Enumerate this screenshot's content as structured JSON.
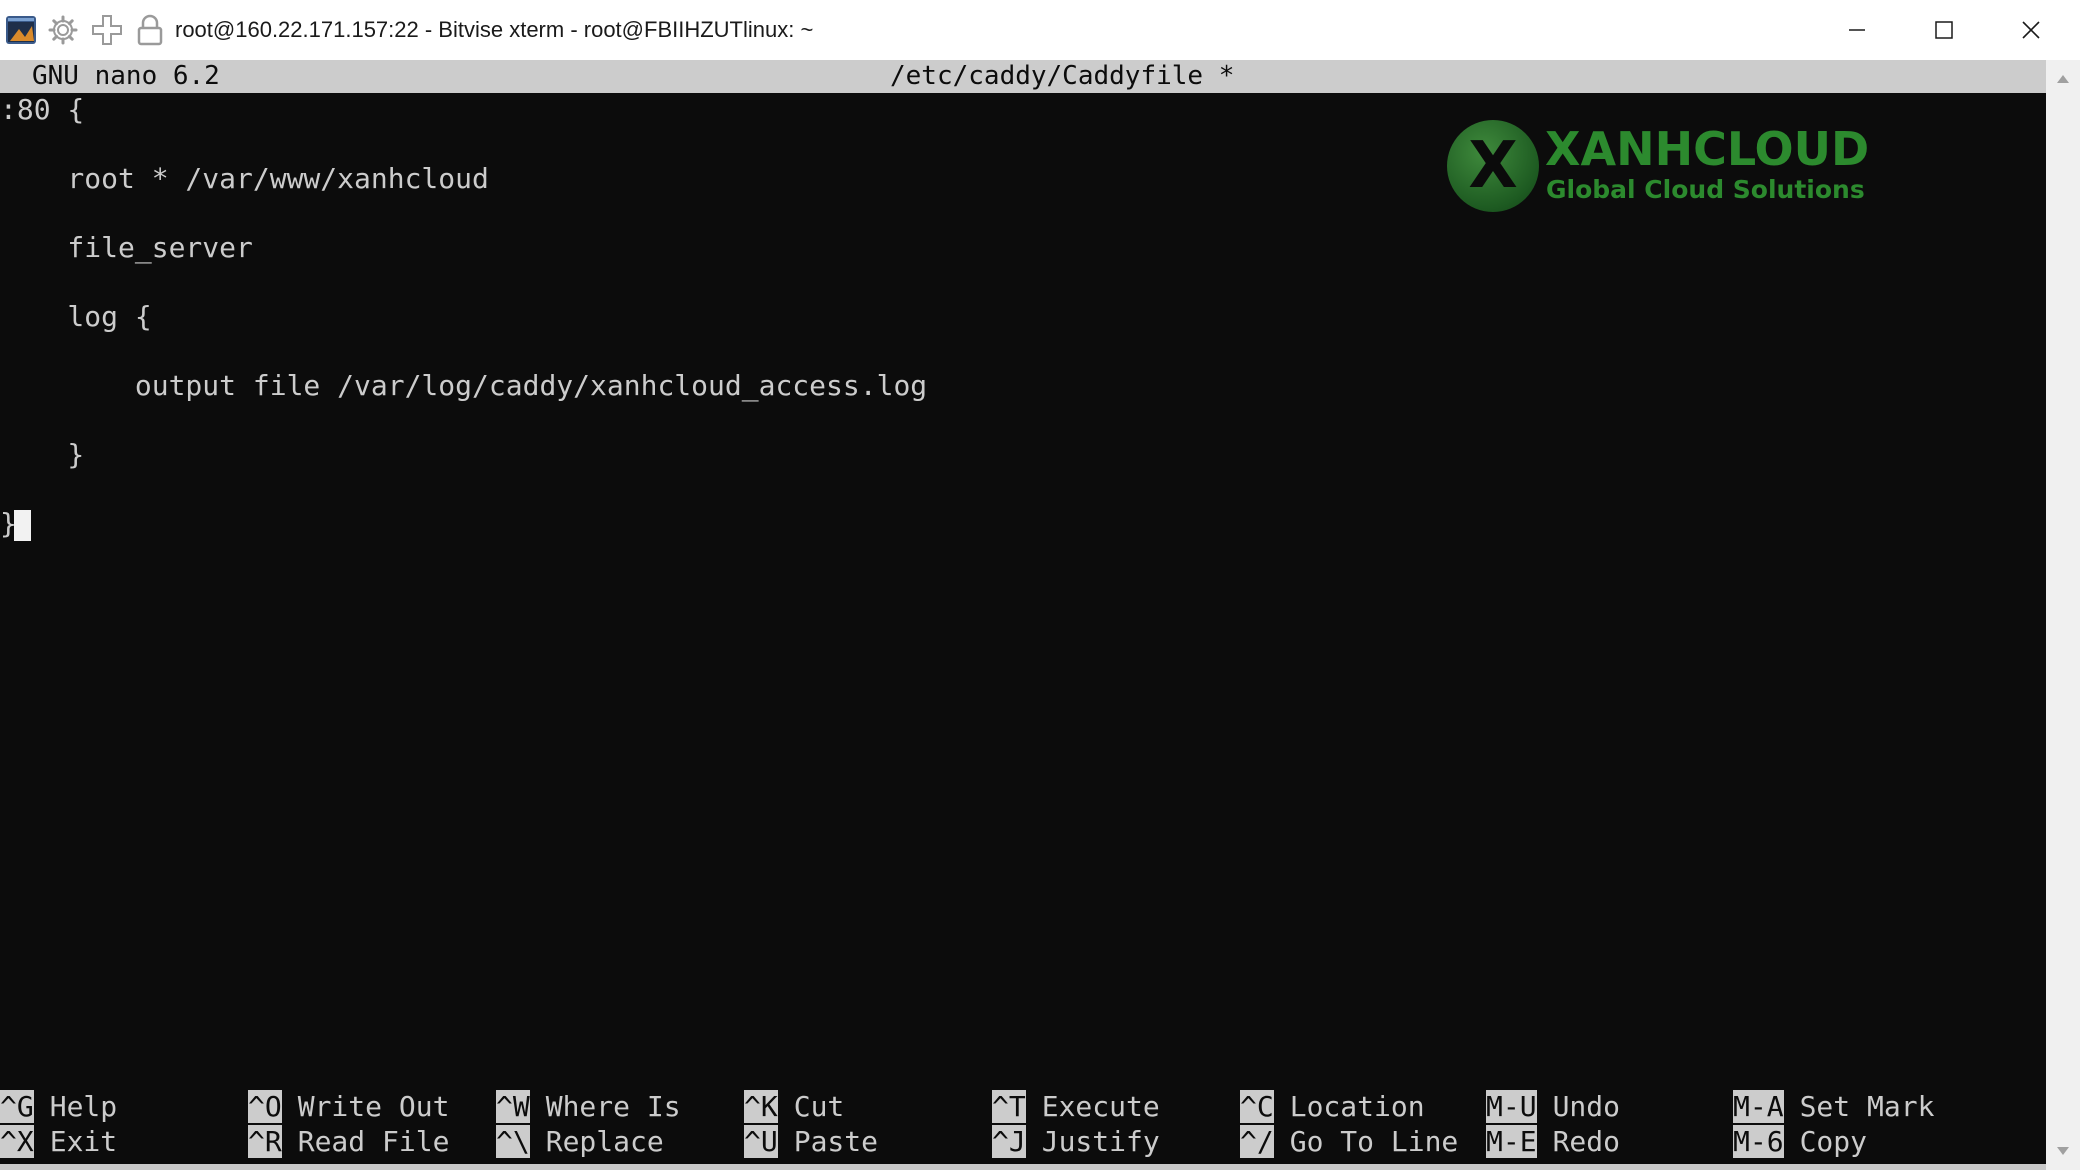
{
  "window": {
    "title": "root@160.22.171.157:22 - Bitvise xterm - root@FBIIHZUTlinux: ~",
    "icons": [
      "terminal-app-icon",
      "gear-icon",
      "move-icon",
      "lock-icon"
    ]
  },
  "nano": {
    "version": "GNU nano 6.2",
    "filename": "/etc/caddy/Caddyfile *"
  },
  "code": {
    "lines": [
      ":80 {",
      "",
      "    root * /var/www/xanhcloud",
      "",
      "    file_server",
      "",
      "    log {",
      "",
      "        output file /var/log/caddy/xanhcloud_access.log",
      "",
      "    }",
      "",
      "}"
    ]
  },
  "logo": {
    "mark": "X",
    "brand": "XANHCLOUD",
    "tagline": "Global Cloud Solutions"
  },
  "shortcuts": [
    {
      "key": "^G",
      "label": "Help"
    },
    {
      "key": "^O",
      "label": "Write Out"
    },
    {
      "key": "^W",
      "label": "Where Is"
    },
    {
      "key": "^K",
      "label": "Cut"
    },
    {
      "key": "^T",
      "label": "Execute"
    },
    {
      "key": "^C",
      "label": "Location"
    },
    {
      "key": "M-U",
      "label": "Undo"
    },
    {
      "key": "M-A",
      "label": "Set Mark"
    },
    {
      "key": "^X",
      "label": "Exit"
    },
    {
      "key": "^R",
      "label": "Read File"
    },
    {
      "key": "^\\",
      "label": "Replace"
    },
    {
      "key": "^U",
      "label": "Paste"
    },
    {
      "key": "^J",
      "label": "Justify"
    },
    {
      "key": "^/",
      "label": "Go To Line"
    },
    {
      "key": "M-E",
      "label": "Redo"
    },
    {
      "key": "M-6",
      "label": "Copy"
    }
  ],
  "colors": {
    "terminal_bg": "#0c0c0c",
    "terminal_fg": "#cccccc",
    "brand_green": "#2c8a2e"
  }
}
